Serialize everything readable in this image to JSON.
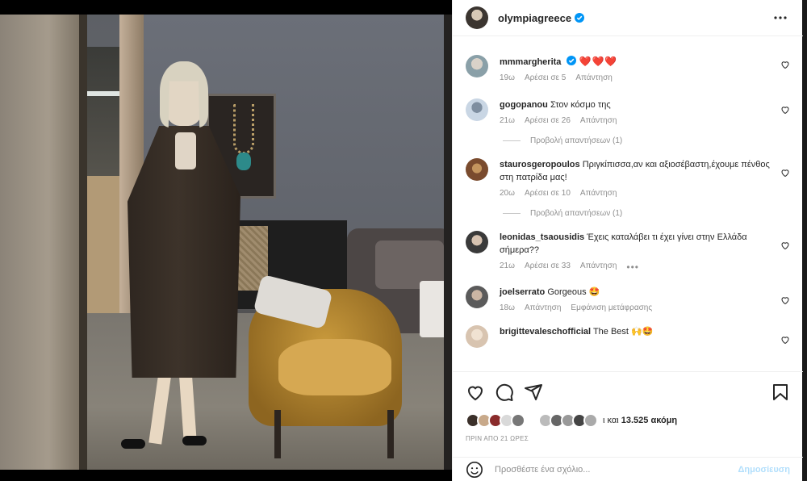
{
  "post": {
    "author": "olympiagreece",
    "author_verified": true,
    "photo_alt": "Mirror selfie in a living room"
  },
  "comments": [
    {
      "username": "mmmargherita",
      "verified": true,
      "text": "❤️❤️❤️",
      "time": "19ω",
      "likes": "Αρέσει σε 5",
      "reply": "Απάντηση",
      "view_replies": "",
      "avatar_color": "#8aa0a8"
    },
    {
      "username": "gogopanou",
      "verified": false,
      "text": "Στον κόσμο της",
      "time": "21ω",
      "likes": "Αρέσει σε 26",
      "reply": "Απάντηση",
      "view_replies": "Προβολή απαντήσεων (1)",
      "avatar_color": "#c9d6e4"
    },
    {
      "username": "staurosgeropoulos",
      "verified": false,
      "text": "Πριγκίπισσα,αν και αξιοσέβαστη,έχουμε πένθος στη πατρίδα μας!",
      "time": "20ω",
      "likes": "Αρέσει σε 10",
      "reply": "Απάντηση",
      "view_replies": "Προβολή απαντήσεων (1)",
      "avatar_color": "#7a4b2e"
    },
    {
      "username": "leonidas_tsaousidis",
      "verified": false,
      "text": "Έχεις καταλάβει τι έχει γίνει στην Ελλάδα σήμερα??",
      "time": "21ω",
      "likes": "Αρέσει σε 33",
      "reply": "Απάντηση",
      "view_replies": "",
      "avatar_color": "#3a3a3a"
    },
    {
      "username": "joelserrato",
      "verified": false,
      "text": "Gorgeous 🤩",
      "time": "18ω",
      "likes": "",
      "reply": "Απάντηση",
      "translate": "Εμφάνιση μετάφρασης",
      "view_replies": "",
      "avatar_color": "#5b5b5b"
    },
    {
      "username": "brigittevaleschofficial",
      "verified": false,
      "text": "The Best 🙌🤩",
      "time": "",
      "likes": "",
      "reply": "",
      "view_replies": "",
      "avatar_color": "#d8c4b0"
    }
  ],
  "likes_summary": {
    "prefix": "ι και",
    "count": "13.525",
    "suffix": "ακόμη"
  },
  "posted_time": "ΠΡΙΝ ΑΠΟ 21 ΩΡΕΣ",
  "add_comment": {
    "placeholder": "Προσθέστε ένα σχόλιο...",
    "post_label": "Δημοσίευση"
  },
  "colors": {
    "accent_blue": "#0095f6",
    "heart_red": "#ed4956",
    "meta_gray": "#8e8e8e"
  }
}
